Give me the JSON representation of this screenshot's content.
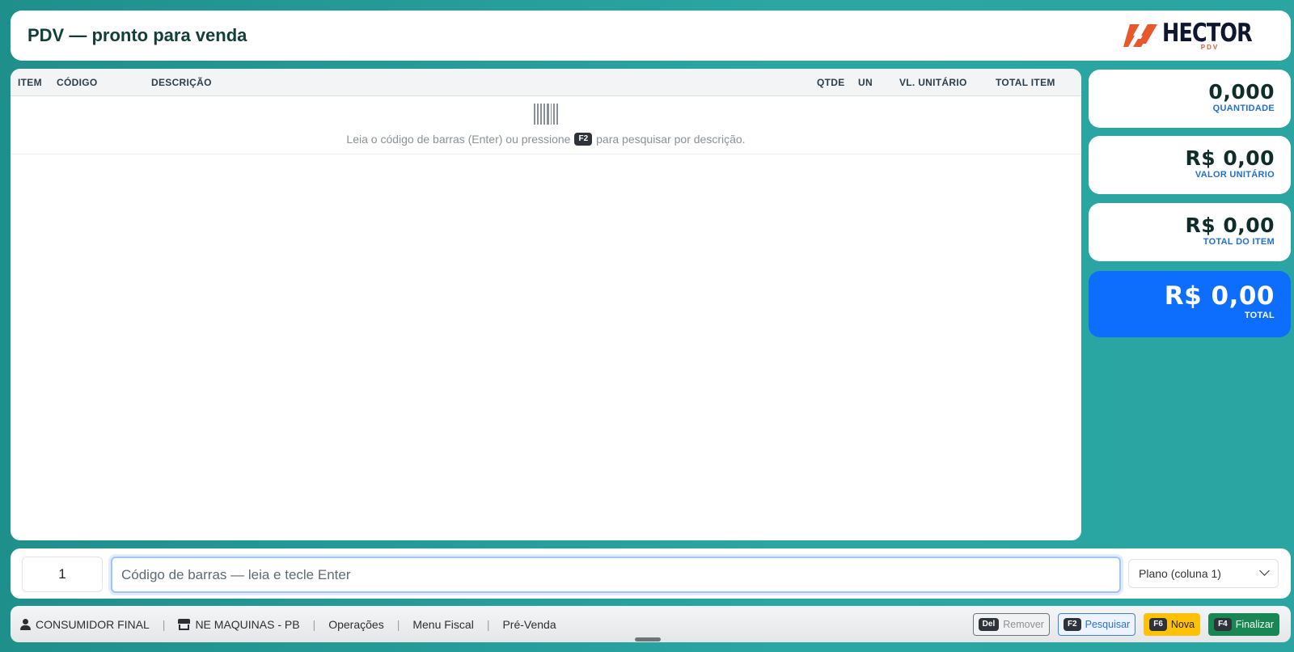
{
  "header": {
    "title": "PDV — pronto para venda",
    "logo_text": "HECTOR",
    "logo_sub": "PDV"
  },
  "table": {
    "columns": [
      "ITEM",
      "CÓDIGO",
      "DESCRIÇÃO",
      "QTDE",
      "UN",
      "VL. UNITÁRIO",
      "TOTAL ITEM"
    ],
    "empty_hint_before": "Leia o código de barras (Enter) ou pressione",
    "empty_hint_key": "F2",
    "empty_hint_after": "para pesquisar por descrição."
  },
  "cards": {
    "quantidade": {
      "value": "0,000",
      "label": "QUANTIDADE"
    },
    "valor_unitario": {
      "value": "R$ 0,00",
      "label": "VALOR UNITÁRIO"
    },
    "total_item": {
      "value": "R$ 0,00",
      "label": "TOTAL DO ITEM"
    },
    "total": {
      "value": "R$ 0,00",
      "label": "TOTAL"
    }
  },
  "input_bar": {
    "quantity": "1",
    "barcode_placeholder": "Código de barras — leia e tecle Enter",
    "plan_selected": "Plano (coluna 1)"
  },
  "status": {
    "customer": "CONSUMIDOR FINAL",
    "store": "NE MAQUINAS - PB",
    "menu": [
      "Operações",
      "Menu Fiscal",
      "Pré-Venda"
    ]
  },
  "actions": {
    "remove": {
      "key": "Del",
      "label": "Remover"
    },
    "search": {
      "key": "F2",
      "label": "Pesquisar"
    },
    "new": {
      "key": "F6",
      "label": "Nova"
    },
    "finalize": {
      "key": "F4",
      "label": "Finalizar"
    }
  },
  "colors": {
    "background": "#2aa6a3",
    "primary": "#0d6efd",
    "title": "#123f3a",
    "label": "#1f6fd6",
    "logo_orange": "#e8582c",
    "warning": "#ffc107",
    "success": "#198754"
  }
}
